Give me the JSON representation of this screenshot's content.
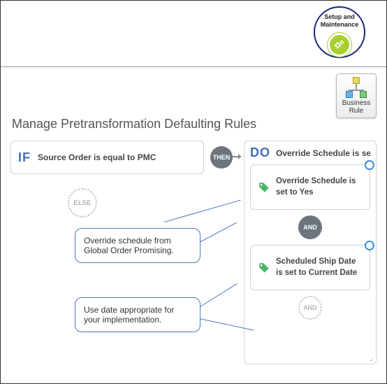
{
  "header": {
    "setup_label_line1": "Setup and",
    "setup_label_line2": "Maintenance"
  },
  "toolbar": {
    "business_rule_label_line1": "Business",
    "business_rule_label_line2": "Rule"
  },
  "title": "Manage Pretransformation Defaulting Rules",
  "if_block": {
    "keyword": "IF",
    "condition": "Source Order is equal to PMC"
  },
  "else_label": "ELSE",
  "then_label": "THEN",
  "do_block": {
    "keyword": "DO",
    "summary": "Override Schedule is set to Yes ar",
    "actions": [
      {
        "text": "Override Schedule is set to Yes"
      },
      {
        "text": "Scheduled Ship Date is set to Current Date"
      }
    ],
    "and_label": "AND",
    "and_dotted_label": "AND"
  },
  "callouts": {
    "c1": "Override  schedule from Global Order Promising.",
    "c2": "Use date appropriate for your implementation."
  }
}
